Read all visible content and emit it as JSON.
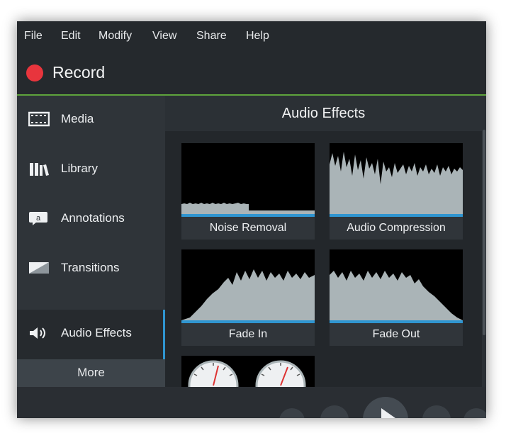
{
  "menu": {
    "items": [
      "File",
      "Edit",
      "Modify",
      "View",
      "Share",
      "Help"
    ]
  },
  "record": {
    "label": "Record"
  },
  "sidebar": {
    "items": [
      {
        "label": "Media",
        "icon": "film-icon"
      },
      {
        "label": "Library",
        "icon": "books-icon"
      },
      {
        "label": "Annotations",
        "icon": "callout-icon"
      },
      {
        "label": "Transitions",
        "icon": "transition-icon"
      },
      {
        "label": "Audio Effects",
        "icon": "speaker-icon",
        "active": true
      }
    ],
    "more_label": "More"
  },
  "panel": {
    "title": "Audio Effects",
    "tiles": [
      {
        "label": "Noise Removal"
      },
      {
        "label": "Audio Compression"
      },
      {
        "label": "Fade In"
      },
      {
        "label": "Fade Out"
      },
      {
        "label": ""
      }
    ]
  },
  "colors": {
    "record": "#e8353d",
    "accent_green": "#5ea33c",
    "accent_blue": "#2f95d0",
    "waveform": "#aab4b7"
  }
}
